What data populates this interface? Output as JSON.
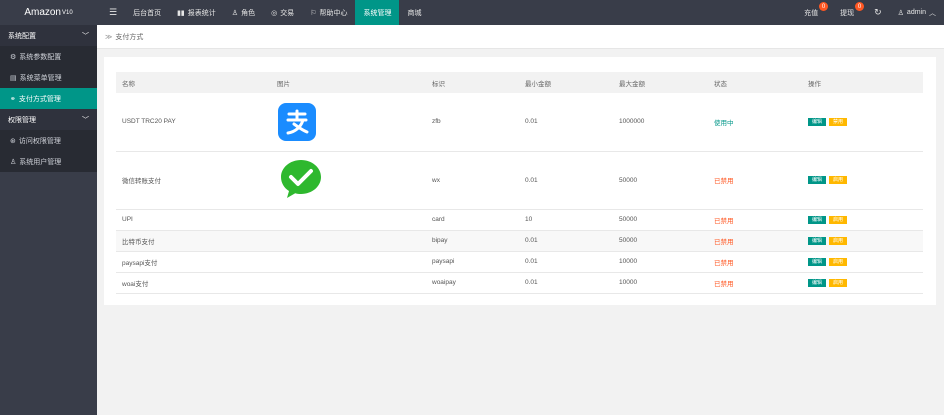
{
  "app": {
    "logo_text": "Amazon",
    "logo_version": "V10"
  },
  "nav": {
    "items": [
      {
        "label": "后台首页",
        "icon": ""
      },
      {
        "label": "报表统计",
        "icon": "bar-chart-icon"
      },
      {
        "label": "角色",
        "icon": "user-icon"
      },
      {
        "label": "交易",
        "icon": "globe-icon"
      },
      {
        "label": "帮助中心",
        "icon": "flag-icon"
      },
      {
        "label": "系统管理",
        "icon": ""
      },
      {
        "label": "商城",
        "icon": ""
      }
    ],
    "active_index": 5,
    "right": {
      "recharge_label": "充值",
      "recharge_badge": "0",
      "withdraw_label": "提现",
      "withdraw_badge": "0",
      "user_label": "admin"
    }
  },
  "sidebar": {
    "group1": "系统配置",
    "group1_items": [
      "系统参数配置",
      "系统菜单管理",
      "支付方式管理"
    ],
    "group2": "权限管理",
    "group2_items": [
      "访问权限管理",
      "系统用户管理"
    ]
  },
  "breadcrumb": {
    "label": "支付方式"
  },
  "table": {
    "headers": [
      "名称",
      "图片",
      "标识",
      "最小金额",
      "最大金额",
      "状态",
      "操作"
    ],
    "edit_label": "编辑",
    "rows": [
      {
        "name": "USDT TRC20 PAY",
        "image": "alipay-logo",
        "code": "zfb",
        "min": "0.01",
        "max": "1000000",
        "status": "使用中",
        "status_on": true,
        "toggle": "禁用"
      },
      {
        "name": "微信转账支付",
        "image": "wechat-logo",
        "code": "wx",
        "min": "0.01",
        "max": "50000",
        "status": "已禁用",
        "status_on": false,
        "toggle": "启用"
      },
      {
        "name": "UPI",
        "image": "",
        "code": "card",
        "min": "10",
        "max": "50000",
        "status": "已禁用",
        "status_on": false,
        "toggle": "启用"
      },
      {
        "name": "比特币支付",
        "image": "",
        "code": "bipay",
        "min": "0.01",
        "max": "50000",
        "status": "已禁用",
        "status_on": false,
        "toggle": "启用"
      },
      {
        "name": "paysapi支付",
        "image": "",
        "code": "paysapi",
        "min": "0.01",
        "max": "10000",
        "status": "已禁用",
        "status_on": false,
        "toggle": "启用"
      },
      {
        "name": "woai支付",
        "image": "",
        "code": "woaipay",
        "min": "0.01",
        "max": "10000",
        "status": "已禁用",
        "status_on": false,
        "toggle": "启用"
      }
    ]
  },
  "colors": {
    "primary": "#009688",
    "dark": "#393d49",
    "danger": "#ff5722",
    "warn": "#ffb800",
    "alipay": "#1a8cff",
    "wechat": "#2eb82e"
  }
}
